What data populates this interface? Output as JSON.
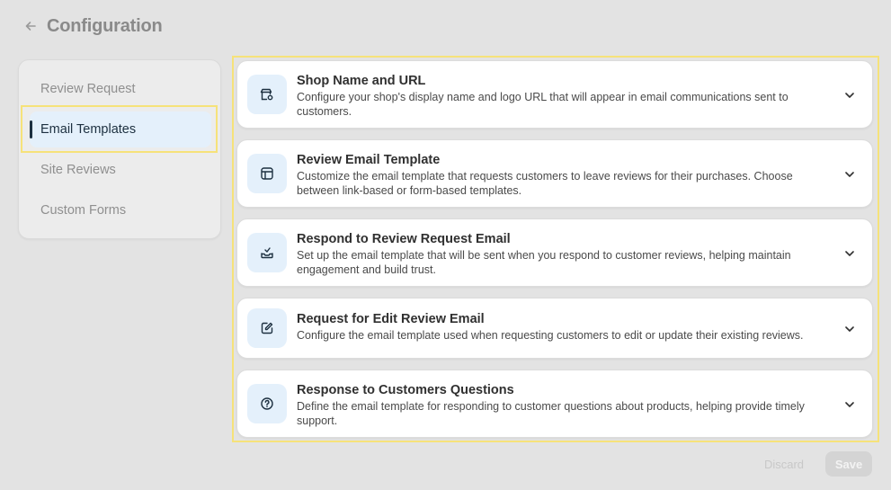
{
  "header": {
    "title": "Configuration"
  },
  "sidebar": {
    "items": [
      {
        "label": "Review Request",
        "active": false
      },
      {
        "label": "Email Templates",
        "active": true
      },
      {
        "label": "Site Reviews",
        "active": false
      },
      {
        "label": "Custom Forms",
        "active": false
      }
    ]
  },
  "cards": [
    {
      "icon": "store-settings-icon",
      "title": "Shop Name and URL",
      "desc_line1": "Configure your shop's display name and logo URL that will appear in email communications sent to",
      "desc_line2": "customers."
    },
    {
      "icon": "template-layout-icon",
      "title": "Review Email Template",
      "desc_line1": "Customize the email template that requests customers to leave reviews for their purchases. Choose",
      "desc_line2": "between link-based or form-based templates."
    },
    {
      "icon": "inbox-reply-icon",
      "title": "Respond to Review Request Email",
      "desc_line1": "Set up the email template that will be sent when you respond to customer reviews, helping maintain",
      "desc_line2": "engagement and build trust."
    },
    {
      "icon": "edit-square-icon",
      "title": "Request for Edit Review Email",
      "desc_line1": "Configure the email template used when requesting customers to edit or update their existing reviews.",
      "desc_line2": ""
    },
    {
      "icon": "question-circle-icon",
      "title": "Response to Customers Questions",
      "desc_line1": "Define the email template for responding to customer questions about products, helping provide timely",
      "desc_line2": "support."
    }
  ],
  "footer": {
    "discard_label": "Discard",
    "save_label": "Save"
  },
  "colors": {
    "accent": "#1d3040",
    "icon_bg": "#e4f0fb",
    "highlight": "#f6e27a"
  }
}
